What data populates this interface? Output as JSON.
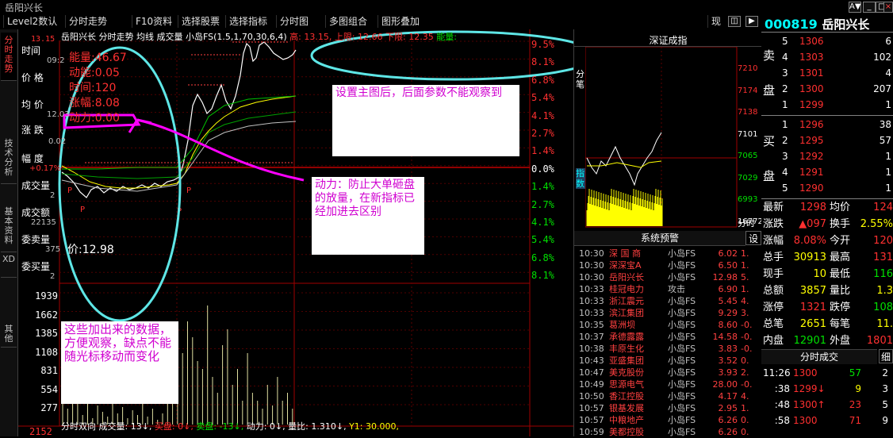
{
  "window": {
    "title": "岳阳兴长"
  },
  "menu": [
    "Level2数认",
    "分时走势",
    "F10资料",
    "选择股票",
    "选择指标",
    "分时图",
    "多图组合",
    "图形叠加",
    "现"
  ],
  "left_tabs": [
    "分时走势",
    "技术分析",
    "基本资料",
    "XD",
    "其他"
  ],
  "chart_header": {
    "text": "岳阳兴长  分时走势  均线  成交量  小岛FS(1.5,1,70,30,6,4)",
    "gao": "高: 13.15,",
    "shangxian": "上限: 12.66",
    "xiaxian": "下限: 12.35",
    "nengliang": "能量:"
  },
  "info_labels": {
    "time": "时间",
    "time_val": "09:2",
    "price": "价  格",
    "avg": "均  价",
    "avg_val": "12.03",
    "change": "涨  跌",
    "change_val": "0.02",
    "range": "幅  度",
    "range_val": "+0.17%",
    "vol": "成交量",
    "vol_val": "2",
    "amount": "成交额",
    "amount_val": "22135",
    "weimai": "委卖量",
    "weimai_val": "375",
    "weimaibuy": "委买量",
    "weimaibuy_val": "2"
  },
  "overlay_params": {
    "nengliang": "能量:46.67",
    "dongneng": "动能:0.05",
    "shijian": "时间:120",
    "zhangfu": "涨幅:8.08",
    "dongli": "动力:0.00",
    "price_label": "价:12.98"
  },
  "left_axis_price": [
    "13.15"
  ],
  "left_axis_vol": [
    "1939",
    "1662",
    "1385",
    "1108",
    "831",
    "554",
    "277",
    "2152"
  ],
  "right_axis_pct": [
    {
      "v": "9.5%",
      "c": "#ff3030"
    },
    {
      "v": "8.1%",
      "c": "#ff3030"
    },
    {
      "v": "6.8%",
      "c": "#ff3030"
    },
    {
      "v": "5.4%",
      "c": "#ff3030"
    },
    {
      "v": "4.1%",
      "c": "#ff3030"
    },
    {
      "v": "2.7%",
      "c": "#ff3030"
    },
    {
      "v": "1.4%",
      "c": "#ff3030"
    },
    {
      "v": "0.0%",
      "c": "#ffffff"
    },
    {
      "v": "1.4%",
      "c": "#00e000"
    },
    {
      "v": "2.7%",
      "c": "#00e000"
    },
    {
      "v": "4.1%",
      "c": "#00e000"
    },
    {
      "v": "5.4%",
      "c": "#00e000"
    },
    {
      "v": "6.8%",
      "c": "#00e000"
    },
    {
      "v": "8.1%",
      "c": "#00e000"
    }
  ],
  "bottom_bar": {
    "text1": "分时双向  成交量: 13↓,",
    "maipan": "买盘: 0↓,",
    "maipan2": "卖盘: -13↓,",
    "dongli": "动力: 0↓,",
    "liangbi": "量比: 1.310↓,",
    "y1": "Y1: 30.000,"
  },
  "callouts": {
    "c1": "设置主图后，后面参数不能观察到",
    "c2": "动力：防止大单砸盘的放量，在新指标已经加进去区别",
    "c3": "这些加出来的数据，方便观察，缺点不能随光标移动而变化"
  },
  "index_panel": {
    "title": "深证成指",
    "left_tabs": [
      "分笔",
      "指数"
    ],
    "axis": [
      "7210",
      "7174",
      "7138",
      "7101",
      "7065",
      "7029",
      "6993",
      "16772"
    ],
    "foot": "分时"
  },
  "alerts": {
    "title": "系统预警",
    "btn": "设",
    "rows": [
      {
        "t": "10:30",
        "n": "深 国 商",
        "s": "小岛FS",
        "p": "6.02",
        "x": "1."
      },
      {
        "t": "10:30",
        "n": "深深宝A",
        "s": "小岛FS",
        "p": "6.50",
        "x": "1."
      },
      {
        "t": "10:30",
        "n": "岳阳兴长",
        "s": "小岛FS",
        "p": "12.98",
        "x": "5."
      },
      {
        "t": "10:33",
        "n": "桂冠电力",
        "s": "攻击",
        "p": "6.90",
        "x": "1."
      },
      {
        "t": "10:33",
        "n": "浙江震元",
        "s": "小岛FS",
        "p": "5.45",
        "x": "4."
      },
      {
        "t": "10:33",
        "n": "滨江集团",
        "s": "小岛FS",
        "p": "9.29",
        "x": "3."
      },
      {
        "t": "10:35",
        "n": "葛洲坝",
        "s": "小岛FS",
        "p": "8.60",
        "x": "-0."
      },
      {
        "t": "10:37",
        "n": "承德露露",
        "s": "小岛FS",
        "p": "14.58",
        "x": "-0."
      },
      {
        "t": "10:38",
        "n": "丰原生化",
        "s": "小岛FS",
        "p": "3.83",
        "x": "-0."
      },
      {
        "t": "10:43",
        "n": "亚盛集团",
        "s": "小岛FS",
        "p": "3.52",
        "x": "0."
      },
      {
        "t": "10:47",
        "n": "美克股份",
        "s": "小岛FS",
        "p": "3.93",
        "x": "2."
      },
      {
        "t": "10:49",
        "n": "思源电气",
        "s": "小岛FS",
        "p": "28.00",
        "x": "-0."
      },
      {
        "t": "10:50",
        "n": "香江控股",
        "s": "小岛FS",
        "p": "4.17",
        "x": "4."
      },
      {
        "t": "10:57",
        "n": "银基发展",
        "s": "小岛FS",
        "p": "2.95",
        "x": "1."
      },
      {
        "t": "10:57",
        "n": "中粮地产",
        "s": "小岛FS",
        "p": "6.26",
        "x": "0."
      },
      {
        "t": "10:59",
        "n": "美都控股",
        "s": "小岛FS",
        "p": "6.26",
        "x": "0."
      }
    ]
  },
  "quote": {
    "code": "000819",
    "name": "岳阳兴长",
    "sell_label": [
      "卖",
      "盘"
    ],
    "buy_label": [
      "买",
      "盘"
    ],
    "sell": [
      {
        "lvl": "5",
        "p": "1306",
        "v": "6"
      },
      {
        "lvl": "4",
        "p": "1303",
        "v": "102"
      },
      {
        "lvl": "3",
        "p": "1301",
        "v": "4"
      },
      {
        "lvl": "2",
        "p": "1300",
        "v": "207"
      },
      {
        "lvl": "1",
        "p": "1299",
        "v": "1"
      }
    ],
    "buy": [
      {
        "lvl": "1",
        "p": "1296",
        "v": "38"
      },
      {
        "lvl": "2",
        "p": "1295",
        "v": "57"
      },
      {
        "lvl": "3",
        "p": "1292",
        "v": "1"
      },
      {
        "lvl": "4",
        "p": "1291",
        "v": "1"
      },
      {
        "lvl": "5",
        "p": "1290",
        "v": "1"
      }
    ],
    "stats": [
      {
        "k": "最新",
        "v": "1298",
        "vc": "#ff3030",
        "k2": "均价",
        "v2": "124",
        "v2c": "#ff3030"
      },
      {
        "k": "涨跌",
        "v": "▲097",
        "vc": "#ff3030",
        "k2": "换手",
        "v2": "2.55%",
        "v2c": "#ffff00"
      },
      {
        "k": "涨幅",
        "v": "8.08%",
        "vc": "#ff3030",
        "k2": "今开",
        "v2": "120",
        "v2c": "#ff3030"
      },
      {
        "k": "总手",
        "v": "30913",
        "vc": "#ffff00",
        "k2": "最高",
        "v2": "131",
        "v2c": "#ff3030"
      },
      {
        "k": "现手",
        "v": "10",
        "vc": "#ffff00",
        "k2": "最低",
        "v2": "116",
        "v2c": "#00e000"
      },
      {
        "k": "总额",
        "v": "3857",
        "vc": "#ffff00",
        "k2": "量比",
        "v2": "1.3",
        "v2c": "#ffff00"
      },
      {
        "k": "涨停",
        "v": "1321",
        "vc": "#ff3030",
        "k2": "跌停",
        "v2": "108",
        "v2c": "#00e000"
      },
      {
        "k": "总笔",
        "v": "2651",
        "vc": "#ffff00",
        "k2": "每笔",
        "v2": "11.",
        "v2c": "#ffff00"
      },
      {
        "k": "内盘",
        "v": "12901",
        "vc": "#00e000",
        "k2": "外盘",
        "v2": "1801",
        "v2c": "#ff3030"
      }
    ],
    "ticks_title": "分时成交",
    "ticks_btn": "细",
    "ticks": [
      {
        "t": "11:26",
        "p": "1300",
        "pc": "#ff3030",
        "v": "57",
        "vc": "#00e000",
        "n": "2"
      },
      {
        "t": ":38",
        "p": "1299↓",
        "pc": "#ff3030",
        "v": "9",
        "vc": "#ffff00",
        "n": "3"
      },
      {
        "t": ":48",
        "p": "1300↑",
        "pc": "#ff3030",
        "v": "23",
        "vc": "#ff3030",
        "n": "5"
      },
      {
        "t": ":58",
        "p": "1300",
        "pc": "#ff3030",
        "v": "71",
        "vc": "#ff3030",
        "n": "9"
      }
    ]
  }
}
